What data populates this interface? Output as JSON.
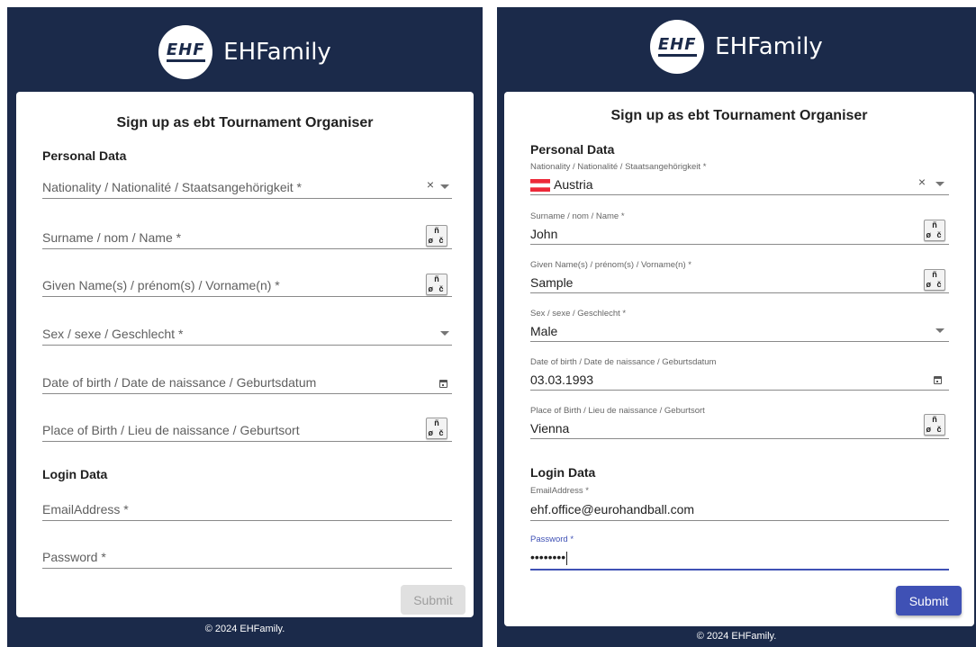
{
  "brand": {
    "logo_text": "EHF",
    "name": "EHFamily"
  },
  "footer": "© 2024 EHFamily.",
  "form": {
    "title": "Sign up as ebt Tournament Organiser",
    "personal_section": "Personal Data",
    "login_section": "Login Data",
    "submit_label": "Submit",
    "special_chars_top": "ñ",
    "special_chars_bottom": "ø č",
    "clear_glyph": "×",
    "labels": {
      "nationality": "Nationality / Nationalité / Staatsangehörigkeit *",
      "surname": "Surname / nom / Name *",
      "given_name": "Given Name(s) / prénom(s) / Vorname(n) *",
      "sex": "Sex / sexe / Geschlecht *",
      "dob": "Date of birth / Date de naissance / Geburtsdatum",
      "pob": "Place of Birth / Lieu de naissance / Geburtsort",
      "email": "EmailAddress *",
      "password": "Password *"
    }
  },
  "filled": {
    "nationality": "Austria",
    "surname": "John",
    "given_name": "Sample",
    "sex": "Male",
    "dob": "03.03.1993",
    "pob": "Vienna",
    "email": "ehf.office@eurohandball.com",
    "password": "••••••••"
  },
  "colors": {
    "header_bg": "#1b2a4a",
    "accent": "#3f51b5",
    "austria_red": "#ed2939",
    "submit_disabled_bg": "#e0e0e0"
  },
  "state": {
    "left_submit_enabled": false,
    "right_submit_enabled": true,
    "focused_field": "password"
  }
}
